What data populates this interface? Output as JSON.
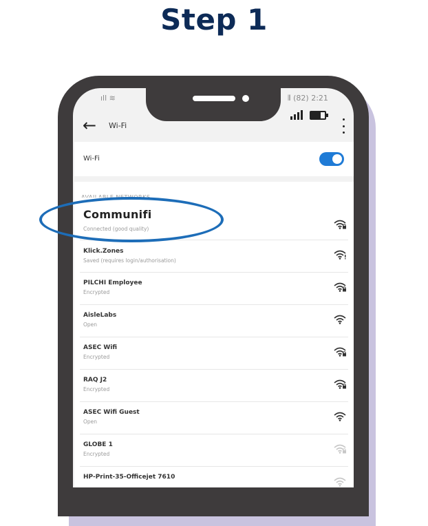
{
  "page": {
    "step_title": "Step 1"
  },
  "status_bar": {
    "ghost_left": "ıll ≋",
    "ghost_right": "⫴ (82) 2:21"
  },
  "header": {
    "title": "Wi-Fi"
  },
  "wifi_toggle": {
    "label": "Wi-Fi",
    "state": "on",
    "accent": "#1f7bd6"
  },
  "networks": {
    "section_label": "AVAILABLE NETWORKS",
    "items": [
      {
        "name": "Communifi",
        "status": "Connected (good quality)",
        "icon": "wifi-locked-icon"
      },
      {
        "name": "Klick.Zones",
        "status": "Saved (requires login/authorisation)",
        "icon": "wifi-alert-icon"
      },
      {
        "name": "PILCHI Employee",
        "status": "Encrypted",
        "icon": "wifi-locked-icon"
      },
      {
        "name": "AisleLabs",
        "status": "Open",
        "icon": "wifi-icon"
      },
      {
        "name": "ASEC Wifi",
        "status": "Encrypted",
        "icon": "wifi-locked-icon"
      },
      {
        "name": "RAQ J2",
        "status": "Encrypted",
        "icon": "wifi-locked-icon"
      },
      {
        "name": "ASEC Wifi Guest",
        "status": "Open",
        "icon": "wifi-icon"
      },
      {
        "name": "GLOBE 1",
        "status": "Encrypted",
        "icon": "wifi-locked-icon"
      },
      {
        "name": "HP-Print-35-Officejet 7610",
        "status": "",
        "icon": "wifi-icon"
      }
    ]
  },
  "colors": {
    "title": "#0d2b57",
    "highlight": "#1d6db8",
    "phone_frame": "#3e3b3c",
    "phone_shadow": "#c9c3df"
  }
}
